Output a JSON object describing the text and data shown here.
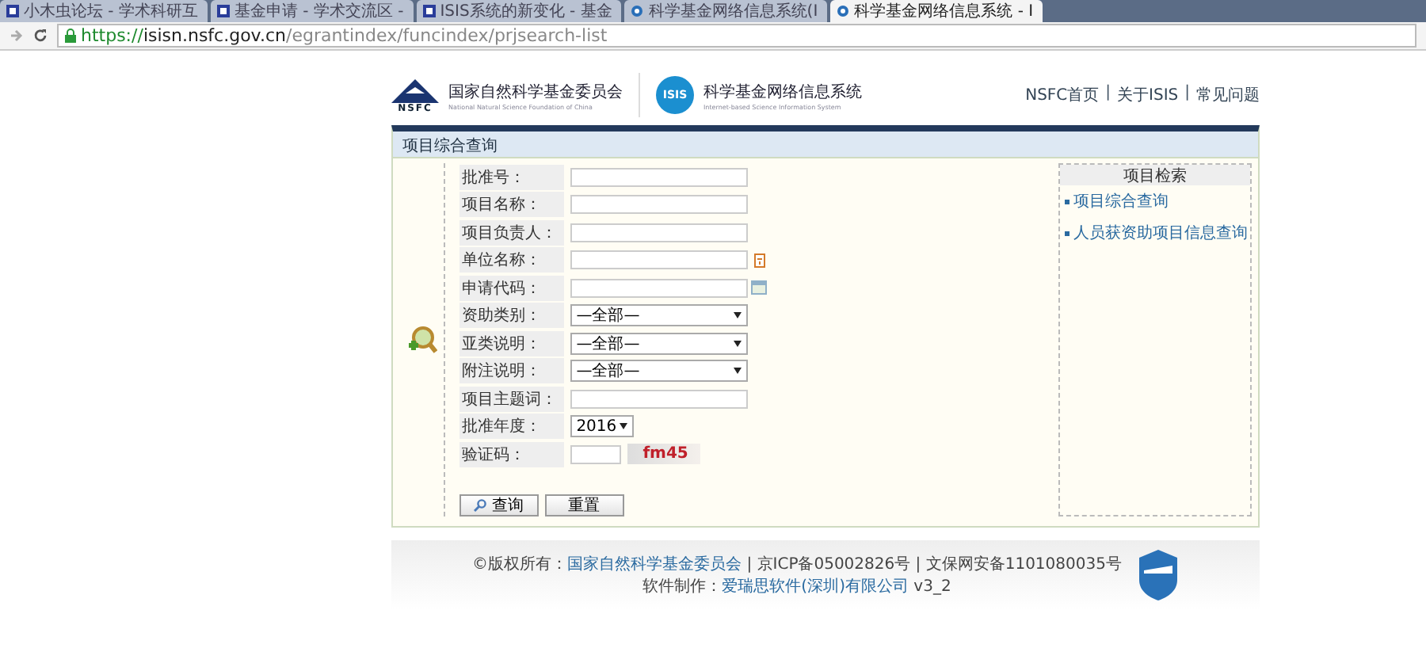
{
  "browser": {
    "tabs": [
      {
        "title": "小木虫论坛 - 学术科研互",
        "selected": false,
        "kind": "square"
      },
      {
        "title": "基金申请 - 学术交流区 - ",
        "selected": false,
        "kind": "square"
      },
      {
        "title": "ISIS系统的新变化 - 基金",
        "selected": false,
        "kind": "square"
      },
      {
        "title": "科学基金网络信息系统(I",
        "selected": false,
        "kind": "circle"
      },
      {
        "title": "科学基金网络信息系统 - I",
        "selected": true,
        "kind": "circle"
      }
    ],
    "url_scheme": "https://",
    "url_host": "isisn.nsfc.gov.cn",
    "url_path": "/egrantindex/funcindex/prjsearch-list"
  },
  "header": {
    "org_logo_text": "NSFC",
    "org_name": "国家自然科学基金委员会",
    "org_name_en": "National Natural Science Foundation of China",
    "system_logo_text": "ISIS",
    "system_name": "科学基金网络信息系统",
    "system_name_en": "Internet-based Science Information System",
    "links": [
      "NSFC首页",
      "关于ISIS",
      "常见问题"
    ],
    "separator": "|"
  },
  "panel": {
    "title": "项目综合查询",
    "fields": [
      {
        "label": "批准号：",
        "kind": "text"
      },
      {
        "label": "项目名称：",
        "kind": "text"
      },
      {
        "label": "项目负责人：",
        "kind": "text"
      },
      {
        "label": "单位名称：",
        "kind": "text-help"
      },
      {
        "label": "申请代码：",
        "kind": "text-picker"
      },
      {
        "label": "资助类别：",
        "kind": "select",
        "value": "—全部—"
      },
      {
        "label": "亚类说明：",
        "kind": "select",
        "value": "—全部—"
      },
      {
        "label": "附注说明：",
        "kind": "select",
        "value": "—全部—"
      },
      {
        "label": "项目主题词：",
        "kind": "text"
      },
      {
        "label": "批准年度：",
        "kind": "year",
        "value": "2016"
      },
      {
        "label": "验证码：",
        "kind": "captcha",
        "captcha": "fm45"
      }
    ],
    "buttons": [
      "查询",
      "重置"
    ],
    "sidebar": {
      "title": "项目检索",
      "links": [
        "项目综合查询",
        "人员获资助项目信息查询"
      ]
    }
  },
  "footer": {
    "line1_prefix": "©版权所有：",
    "line1_link": "国家自然科学基金委员会",
    "line1_rest": " | 京ICP备05002826号 | 文保网安备1101080035号",
    "line2_prefix": "软件制作：",
    "line2_link": "爱瑞思软件(深圳)有限公司",
    "line2_rest": " v3_2"
  }
}
